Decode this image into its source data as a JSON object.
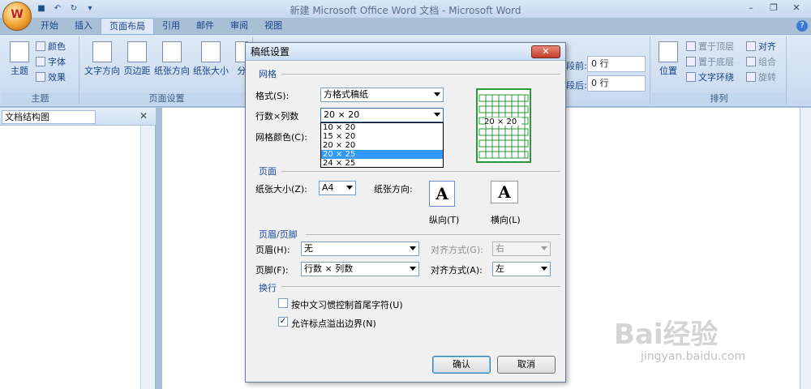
{
  "window": {
    "title": "新建 Microsoft Office Word 文档 - Microsoft Word"
  },
  "qat": {
    "save_icon": "save-icon",
    "undo_icon": "undo-icon",
    "redo_icon": "redo-icon"
  },
  "tabs": [
    "开始",
    "插入",
    "页面布局",
    "引用",
    "邮件",
    "审阅",
    "视图"
  ],
  "active_tab": "页面布局",
  "ribbon": {
    "theme_group": {
      "label": "主题",
      "theme_btn": "主题",
      "colors": "颜色",
      "fonts": "字体",
      "effects": "效果"
    },
    "page_setup_group": {
      "label": "页面设置",
      "text_dir": "文字方向",
      "margins": "页边距",
      "orientation": "纸张方向",
      "size": "纸张大小",
      "columns": "分"
    },
    "spacing": {
      "before_label": "段前:",
      "before_value": "0 行",
      "after_label": "段后:",
      "after_value": "0 行"
    },
    "arrange_group": {
      "label": "排列",
      "position": "位置",
      "bring_front": "置于顶层",
      "send_back": "置于底层",
      "text_wrap": "文字环绕",
      "align": "对齐",
      "group": "组合",
      "rotate": "旋转"
    }
  },
  "nav_pane": {
    "selector": "文档结构图"
  },
  "dialog": {
    "title": "稿纸设置",
    "grid_section": "网格",
    "format_label": "格式(S):",
    "format_value": "方格式稿纸",
    "rowcol_label": "行数×列数",
    "rowcol_value": "20 × 20",
    "rowcol_options": [
      "10 × 20",
      "15 × 20",
      "20 × 20",
      "20 × 25",
      "24 × 25"
    ],
    "rowcol_selected_index": 3,
    "grid_color_label": "网格颜色(C):",
    "preview_text": "20 × 20",
    "page_section": "页面",
    "paper_size_label": "纸张大小(Z):",
    "paper_size_value": "A4",
    "orientation_label": "纸张方向:",
    "portrait_label": "纵向(T)",
    "landscape_label": "横向(L)",
    "hf_section": "页眉/页脚",
    "header_label": "页眉(H):",
    "header_value": "无",
    "header_align_label": "对齐方式(G):",
    "header_align_value": "右",
    "footer_label": "页脚(F):",
    "footer_value": "行数 × 列数",
    "footer_align_label": "对齐方式(A):",
    "footer_align_value": "左",
    "wrap_section": "换行",
    "chk1_label": "按中文习惯控制首尾字符(U)",
    "chk1_checked": false,
    "chk2_label": "允许标点溢出边界(N)",
    "chk2_checked": true,
    "ok": "确认",
    "cancel": "取消"
  },
  "watermark": {
    "main": "Bai经验",
    "sub": "jingyan.baidu.com"
  }
}
